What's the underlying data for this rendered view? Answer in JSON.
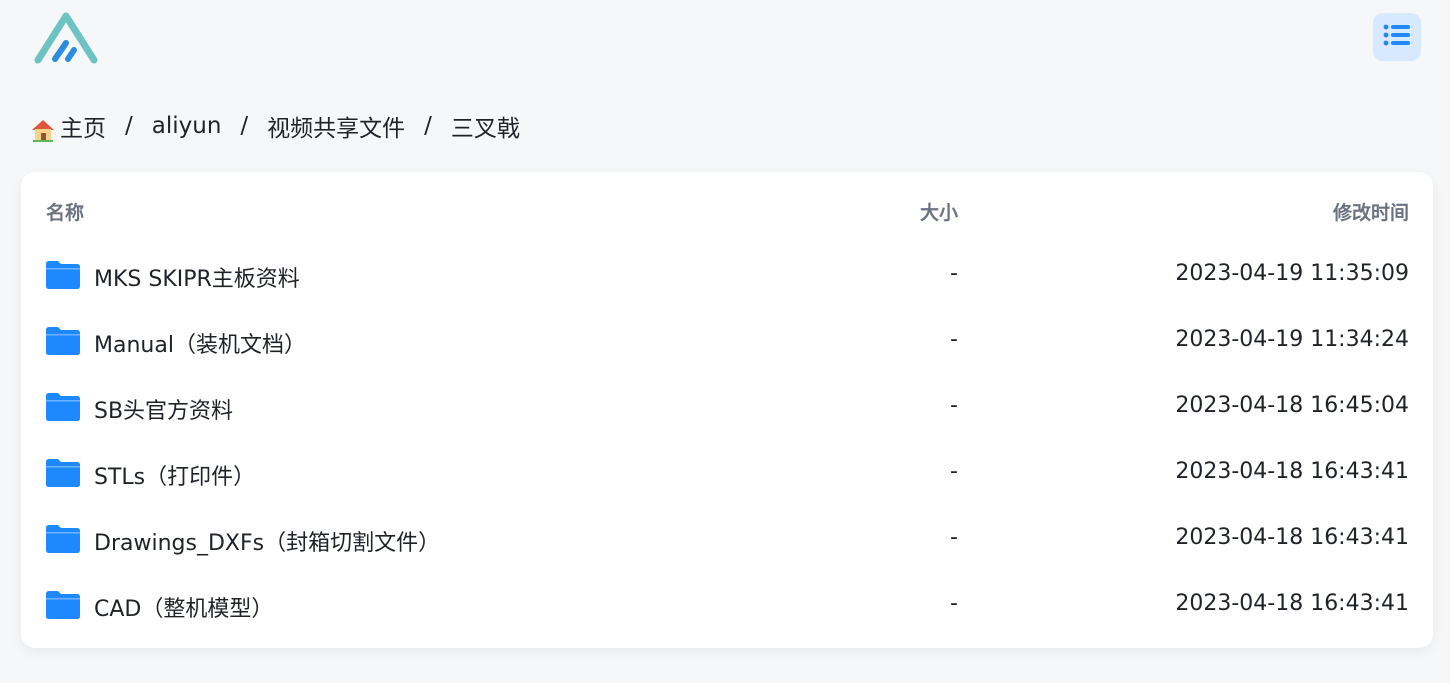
{
  "header": {
    "logo_icon": "logo-icon",
    "menu_icon": "list-icon"
  },
  "breadcrumb": [
    {
      "label": "主页",
      "icon": "home-icon"
    },
    {
      "label": "aliyun"
    },
    {
      "label": "视频共享文件"
    },
    {
      "label": "三叉戟"
    }
  ],
  "breadcrumb_separator": "/",
  "table": {
    "columns": {
      "name": "名称",
      "size": "大小",
      "time": "修改时间"
    },
    "rows": [
      {
        "name": "MKS SKIPR主板资料",
        "size": "-",
        "time": "2023-04-19 11:35:09",
        "icon": "folder-icon"
      },
      {
        "name": "Manual（装机文档）",
        "size": "-",
        "time": "2023-04-19 11:34:24",
        "icon": "folder-icon"
      },
      {
        "name": "SB头官方资料",
        "size": "-",
        "time": "2023-04-18 16:45:04",
        "icon": "folder-icon"
      },
      {
        "name": "STLs（打印件）",
        "size": "-",
        "time": "2023-04-18 16:43:41",
        "icon": "folder-icon"
      },
      {
        "name": "Drawings_DXFs（封箱切割文件）",
        "size": "-",
        "time": "2023-04-18 16:43:41",
        "icon": "folder-icon"
      },
      {
        "name": "CAD（整机模型）",
        "size": "-",
        "time": "2023-04-18 16:43:41",
        "icon": "folder-icon"
      }
    ]
  },
  "colors": {
    "accent": "#1e88ff",
    "menu_bg": "#d7e9ff",
    "logo_teal": "#6cc3c1",
    "logo_blue": "#2a8de0"
  }
}
